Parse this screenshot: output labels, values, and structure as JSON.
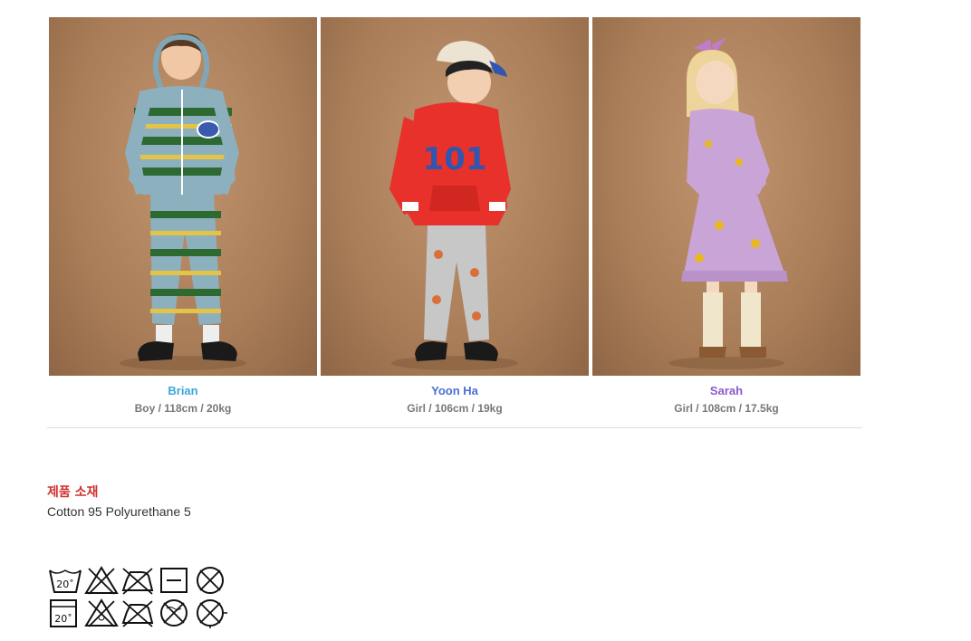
{
  "models": [
    {
      "name": "Brian",
      "name_color": "#3aa6d8",
      "stats": "Boy / 118cm / 20kg",
      "photo": "boy-striped-hoodie-photo"
    },
    {
      "name": "Yoon Ha",
      "name_color": "#4a6fd4",
      "stats": "Girl / 106cm / 19kg",
      "photo": "girl-red-hoodie-photo"
    },
    {
      "name": "Sarah",
      "name_color": "#8a5ad0",
      "stats": "Girl / 108cm / 17.5kg",
      "photo": "girl-lilac-dress-photo"
    }
  ],
  "material": {
    "title": "제품 소재",
    "value": "Cotton 95 Polyurethane 5"
  },
  "care_labels": {
    "wash_temp": "20˚",
    "machine_wash_temp": "20˚"
  }
}
